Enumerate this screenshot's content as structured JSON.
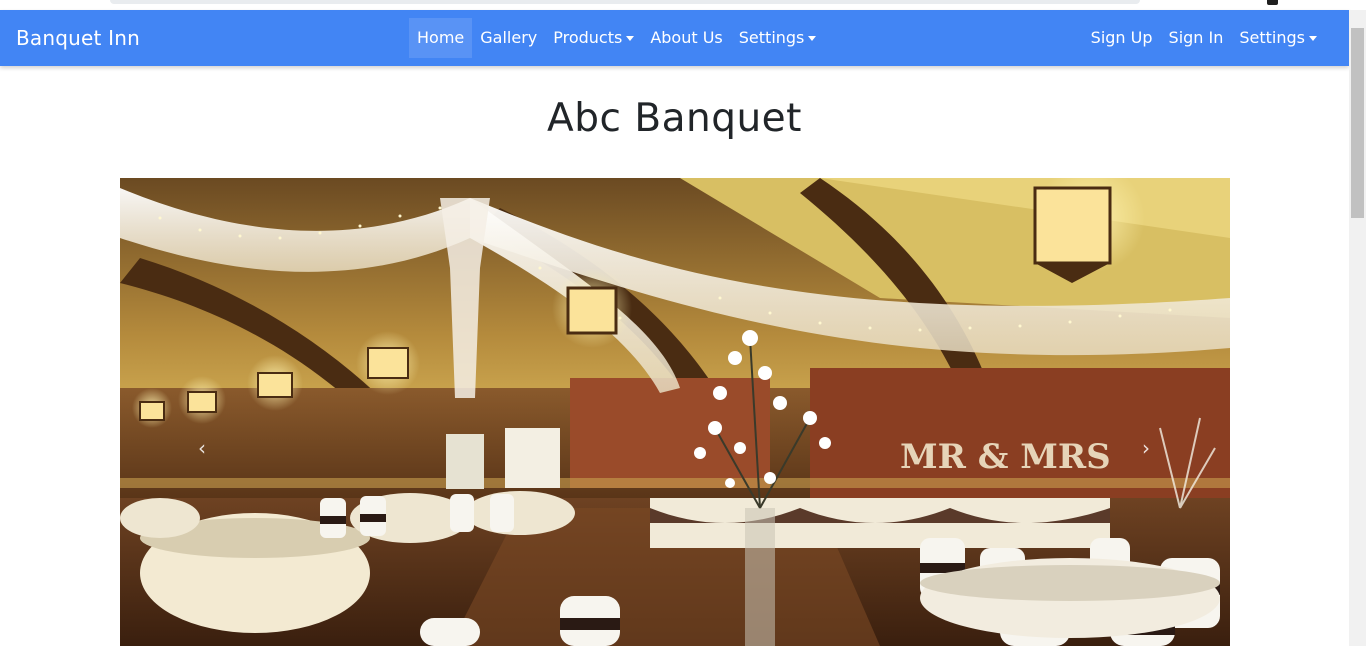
{
  "navbar": {
    "brand": "Banquet Inn",
    "left_items": [
      {
        "label": "Home",
        "active": true
      },
      {
        "label": "Gallery"
      },
      {
        "label": "Products",
        "dropdown": true
      },
      {
        "label": "About Us"
      },
      {
        "label": "Settings",
        "dropdown": true
      }
    ],
    "right_items": [
      {
        "label": "Sign Up"
      },
      {
        "label": "Sign In"
      },
      {
        "label": "Settings",
        "dropdown": true
      }
    ],
    "color": "#4285f4"
  },
  "main": {
    "title": "Abc Banquet",
    "carousel": {
      "prev_icon": "‹",
      "next_icon": "›",
      "slide_text": "MR & MRS"
    }
  }
}
